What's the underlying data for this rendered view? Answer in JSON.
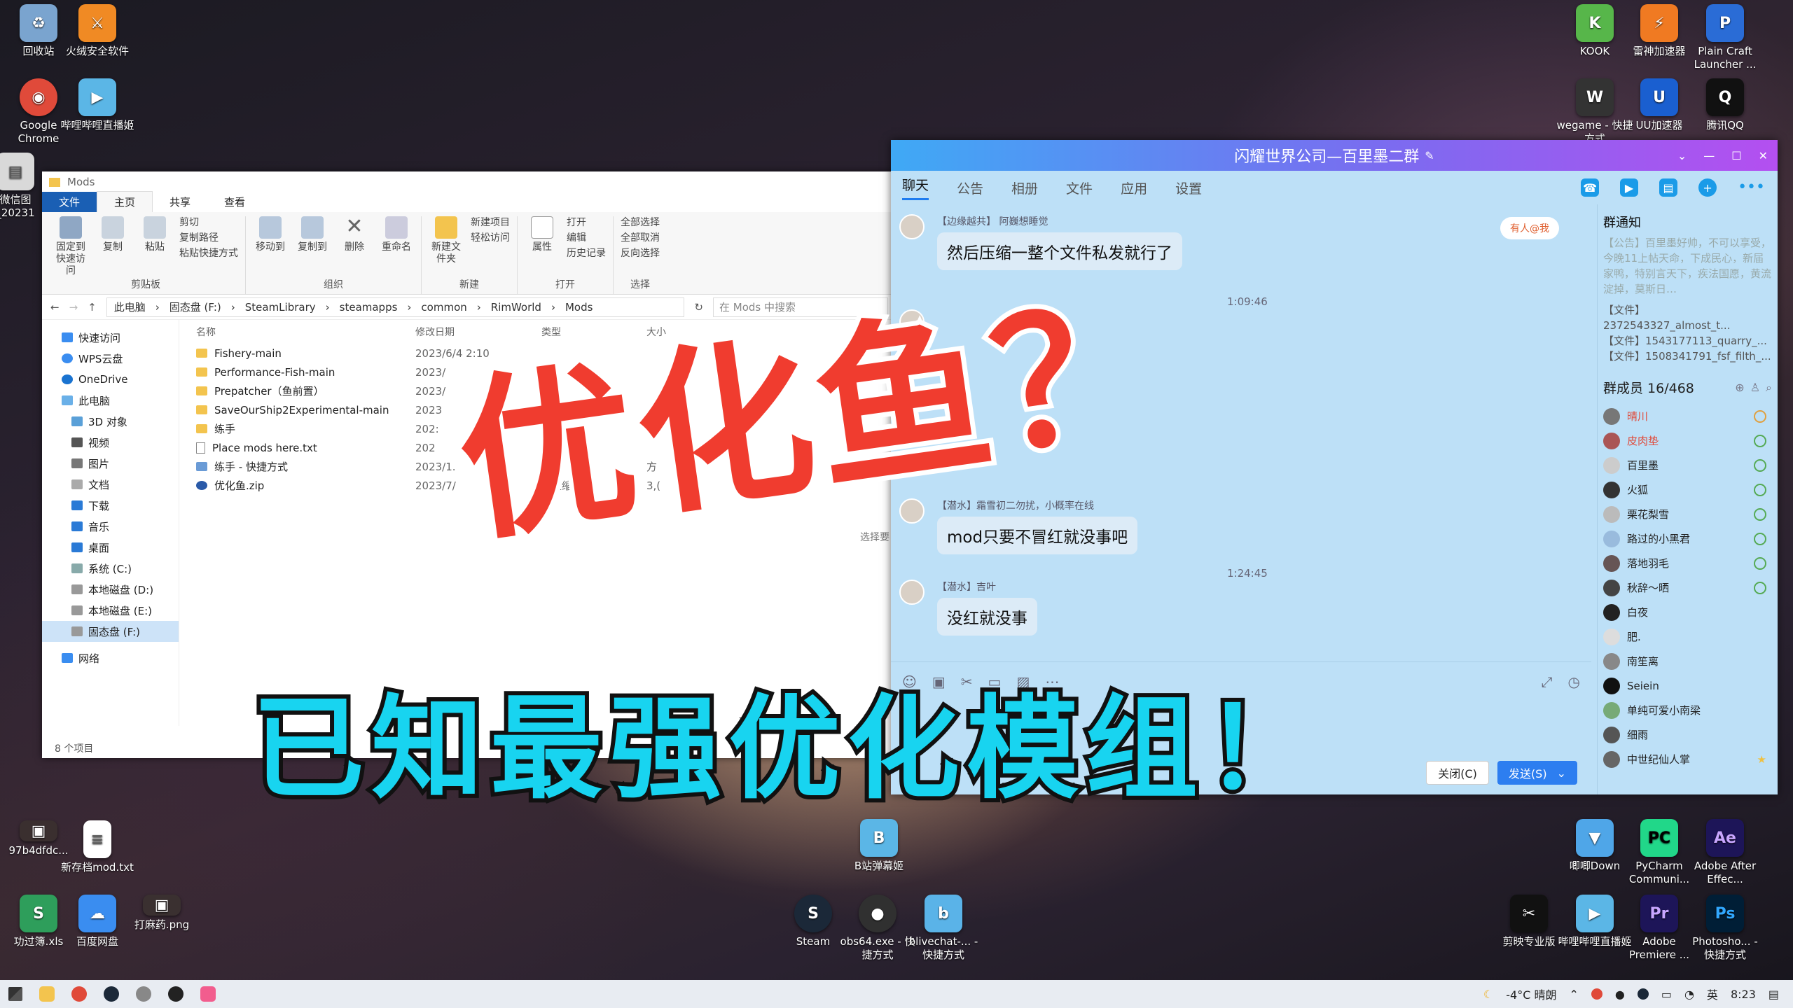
{
  "desktop": {
    "icons_left": [
      {
        "label": "回收站",
        "color": "#7aa4cf",
        "glyph": "♻"
      },
      {
        "label": "火绒安全软件",
        "color": "#f08a24",
        "glyph": "⚔"
      },
      {
        "label": "Google Chrome",
        "color": "#e04a3a",
        "glyph": "◉"
      },
      {
        "label": "哔哩哔哩直播姬",
        "color": "#5bb6e6",
        "glyph": "▶"
      },
      {
        "label": "微信图_20231",
        "color": "#d9d9d9",
        "glyph": "▤"
      }
    ],
    "icons_right": [
      {
        "label": "KOOK",
        "color": "#57b64a",
        "glyph": "K"
      },
      {
        "label": "雷神加速器",
        "color": "#f07a22",
        "glyph": "⚡"
      },
      {
        "label": "Plain Craft Launcher ...",
        "color": "#2a6cd6",
        "glyph": "P"
      },
      {
        "label": "wegame - 快捷方式",
        "color": "#333333",
        "glyph": "W"
      },
      {
        "label": "UU加速器",
        "color": "#1a5fd0",
        "glyph": "U"
      },
      {
        "label": "腾讯QQ",
        "color": "#111111",
        "glyph": "Q"
      }
    ],
    "icons_bottom_left": [
      {
        "label": "97b4dfdc...",
        "color": "#3a2f2f",
        "glyph": "▣"
      },
      {
        "label": "新存档mod.txt",
        "color": "#ffffff",
        "glyph": "≡"
      },
      {
        "label": "功过簿.xls",
        "color": "#2e9e5b",
        "glyph": "S"
      },
      {
        "label": "百度网盘",
        "color": "#3a8df0",
        "glyph": "☁"
      },
      {
        "label": "打麻药.png",
        "color": "#3a3030",
        "glyph": "▣"
      }
    ],
    "icons_bottom_center": [
      {
        "label": "B站弹幕姬",
        "color": "#5bb6e6",
        "glyph": "B"
      },
      {
        "label": "Steam",
        "color": "#1b2838",
        "glyph": "S"
      },
      {
        "label": "obs64.exe - 快捷方式",
        "color": "#303030",
        "glyph": "●"
      },
      {
        "label": "blivechat-... - 快捷方式",
        "color": "#5ab3e8",
        "glyph": "b"
      }
    ],
    "icons_bottom_right": [
      {
        "label": "唧唧Down",
        "color": "#4fa6e8",
        "glyph": "▼"
      },
      {
        "label": "PyCharm Communi...",
        "color": "#21d789",
        "glyph": "PC"
      },
      {
        "label": "Adobe After Effec...",
        "color": "#1d1558",
        "glyph": "Ae"
      },
      {
        "label": "剪映专业版",
        "color": "#111111",
        "glyph": "✂"
      },
      {
        "label": "哔哩哔哩直播姬",
        "color": "#5bb6e6",
        "glyph": "▶"
      },
      {
        "label": "Adobe Premiere ...",
        "color": "#1d1558",
        "glyph": "Pr"
      },
      {
        "label": "Photosho... - 快捷方式",
        "color": "#001e36",
        "glyph": "Ps"
      }
    ]
  },
  "explorer": {
    "title": "Mods",
    "tabs": [
      "文件",
      "主页",
      "共享",
      "查看"
    ],
    "ribbon": {
      "clipboard": {
        "pin": "固定到快速访问",
        "copy": "复制",
        "paste": "粘贴",
        "cut": "剪切",
        "copy_path": "复制路径",
        "paste_shortcut": "粘贴快捷方式",
        "label": "剪贴板"
      },
      "organize": {
        "move": "移动到",
        "copyto": "复制到",
        "delete": "删除",
        "rename": "重命名",
        "label": "组织"
      },
      "new": {
        "new_folder": "新建文件夹",
        "new_item": "新建项目",
        "easy_access": "轻松访问",
        "label": "新建"
      },
      "open": {
        "props": "属性",
        "open": "打开",
        "edit": "编辑",
        "history": "历史记录",
        "label": "打开"
      },
      "select": {
        "all": "全部选择",
        "none": "全部取消",
        "invert": "反向选择",
        "label": "选择"
      }
    },
    "breadcrumb": [
      "此电脑",
      "固态盘 (F:)",
      "SteamLibrary",
      "steamapps",
      "common",
      "RimWorld",
      "Mods"
    ],
    "search_placeholder": "在 Mods 中搜索",
    "nav": [
      "快速访问",
      "WPS云盘",
      "OneDrive",
      "此电脑",
      "3D 对象",
      "视频",
      "图片",
      "文档",
      "下载",
      "音乐",
      "桌面",
      "系统 (C:)",
      "本地磁盘 (D:)",
      "本地磁盘 (E:)",
      "固态盘 (F:)",
      "网络"
    ],
    "columns": [
      "名称",
      "修改日期",
      "类型",
      "大小"
    ],
    "rows": [
      {
        "name": "Fishery-main",
        "date": "2023/6/4 2:10",
        "type": "",
        "size": "",
        "kind": "folder"
      },
      {
        "name": "Performance-Fish-main",
        "date": "2023/",
        "type": "7",
        "size": "",
        "kind": "folder"
      },
      {
        "name": "Prepatcher（鱼前置）",
        "date": "2023/",
        "type": ":17",
        "size": "",
        "kind": "folder"
      },
      {
        "name": "SaveOurShip2Experimental-main",
        "date": "2023",
        "type": "",
        "size": "",
        "kind": "folder"
      },
      {
        "name": "练手",
        "date": "202:",
        "type": "",
        "size": "",
        "kind": "folder"
      },
      {
        "name": "Place mods here.txt",
        "date": "202",
        "type": "5",
        "size": "",
        "kind": "doc"
      },
      {
        "name": "练手 - 快捷方式",
        "date": "2023/1.",
        "type": "13",
        "size": "方",
        "kind": "link"
      },
      {
        "name": "优化鱼.zip",
        "date": "2023/7/",
        "type": "P 压缩",
        "size": "3,(",
        "kind": "zip"
      }
    ],
    "preview_hint": "选择要",
    "status": "8 个项目"
  },
  "qq": {
    "title": "闪耀世界公司—百里墨二群",
    "tabs": [
      "聊天",
      "公告",
      "相册",
      "文件",
      "应用",
      "设置"
    ],
    "mention_badge": "有人@我",
    "messages": [
      {
        "name": "【边缘越共】 阿巍想睡觉",
        "text": "然后压缩一整个文件私发就行了"
      },
      {
        "name": "【潜水】霜雪初二勿扰，小概率在线",
        "text": "mod只要不冒红就没事吧"
      },
      {
        "name": "【潜水】吉叶",
        "text": "没红就没事"
      }
    ],
    "times": [
      "1:09:46",
      "1:24:45"
    ],
    "partial_name": "二勿扰",
    "notice_title": "群通知",
    "notice_text": "【公告】百里墨好帅，不可以享受，今晚11上帖天命，下成民心，新届家鸭，特别言天下，疾法国愿，黄流淀掉，莫斯日…",
    "notice_files": [
      "【文件】2372543327_almost_t...",
      "【文件】1543177113_quarry_...",
      "【文件】1508341791_fsf_filth_..."
    ],
    "members_title": "群成员 16/468",
    "members": [
      "晴川",
      "皮肉垫",
      "百里墨",
      "火狐",
      "栗花梨雪",
      "路过的小黑君",
      "落地羽毛",
      "秋辞～晒",
      "白夜",
      "肥.",
      "南笙离",
      "Seiein",
      "单纯可爱小南梁",
      "细雨",
      "中世纪仙人掌"
    ],
    "btn_close": "关闭(C)",
    "btn_send": "发送(S)"
  },
  "overlay": {
    "big_red": "优化鱼？",
    "big_cyan": "已知最强优化模组！"
  },
  "taskbar": {
    "weather": "-4°C 晴朗",
    "ime": "英",
    "clock": "8:23"
  }
}
